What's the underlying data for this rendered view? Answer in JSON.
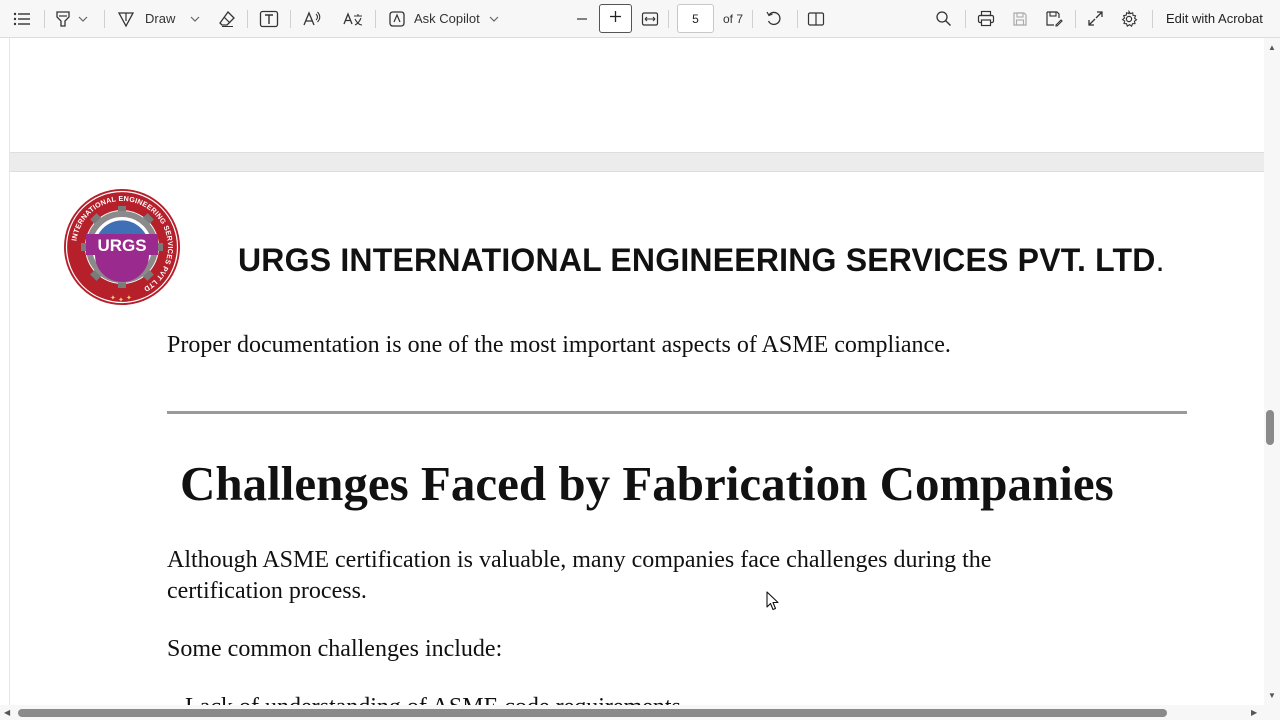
{
  "toolbar": {
    "contents_icon": "list-icon",
    "highlight_icon": "highlighter-icon",
    "draw_label": "Draw",
    "erase_icon": "eraser-icon",
    "text_icon": "text-box-icon",
    "read_aloud_icon": "read-aloud-icon",
    "translate_icon": "translate-icon",
    "copilot_label": "Ask Copilot",
    "zoom_out_icon": "minus-icon",
    "zoom_in_icon": "plus-icon",
    "fit_icon": "fit-width-icon",
    "page_value": "5",
    "page_total": "of 7",
    "rotate_icon": "rotate-icon",
    "page_view_icon": "page-view-icon",
    "search_icon": "search-icon",
    "print_icon": "print-icon",
    "save_icon": "save-icon",
    "save_as_icon": "save-as-icon",
    "fullscreen_icon": "expand-icon",
    "settings_icon": "gear-icon",
    "acrobat_label": "Edit with Acrobat"
  },
  "document": {
    "logo_text": "URGS",
    "logo_ring_text": "INTERNATIONAL ENGINEERING SERVICES PVT LTD",
    "company_name": "URGS INTERNATIONAL ENGINEERING SERVICES PVT. LTD",
    "company_period": ".",
    "para1": "Proper documentation is one of the most important aspects of ASME compliance.",
    "heading": "Challenges Faced by Fabrication Companies",
    "para2": "Although ASME certification is valuable, many companies face challenges during the certification process.",
    "para3": "Some common challenges include:",
    "bullet1_partial": "Lack of understanding of ASME code requirements"
  },
  "colors": {
    "logo_red": "#b5202b",
    "logo_purple": "#9b2a8e",
    "logo_blue": "#3f6fb5"
  }
}
